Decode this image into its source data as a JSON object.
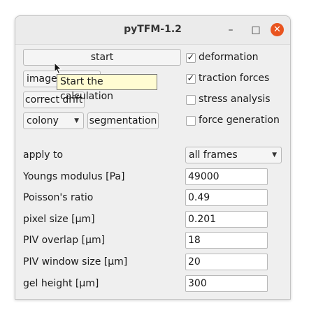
{
  "window": {
    "title": "pyTFM-1.2",
    "minimize": "–",
    "maximize": "□",
    "close": "✕"
  },
  "buttons": {
    "start": "start",
    "image_selection": "image s",
    "correct_drift": "correct drift",
    "segmentation": "segmentation"
  },
  "colony_combo": {
    "value": "colony"
  },
  "checkboxes": [
    {
      "label": "deformation",
      "checked": true
    },
    {
      "label": "traction forces",
      "checked": true
    },
    {
      "label": "stress analysis",
      "checked": false
    },
    {
      "label": "force generation",
      "checked": false
    }
  ],
  "apply_to": {
    "label": "apply to",
    "value": "all frames"
  },
  "params": [
    {
      "label": "Youngs modulus [Pa]",
      "value": "49000"
    },
    {
      "label": "Poisson's ratio",
      "value": "0.49"
    },
    {
      "label": "pixel size [µm]",
      "value": "0.201"
    },
    {
      "label": "PIV overlap [µm]",
      "value": "18"
    },
    {
      "label": "PIV window size [µm]",
      "value": "20"
    },
    {
      "label": "gel height [µm]",
      "value": "300"
    }
  ],
  "tooltip": {
    "text": "Start the calculation"
  },
  "icons": {
    "check": "✓",
    "dropdown": "▼"
  }
}
